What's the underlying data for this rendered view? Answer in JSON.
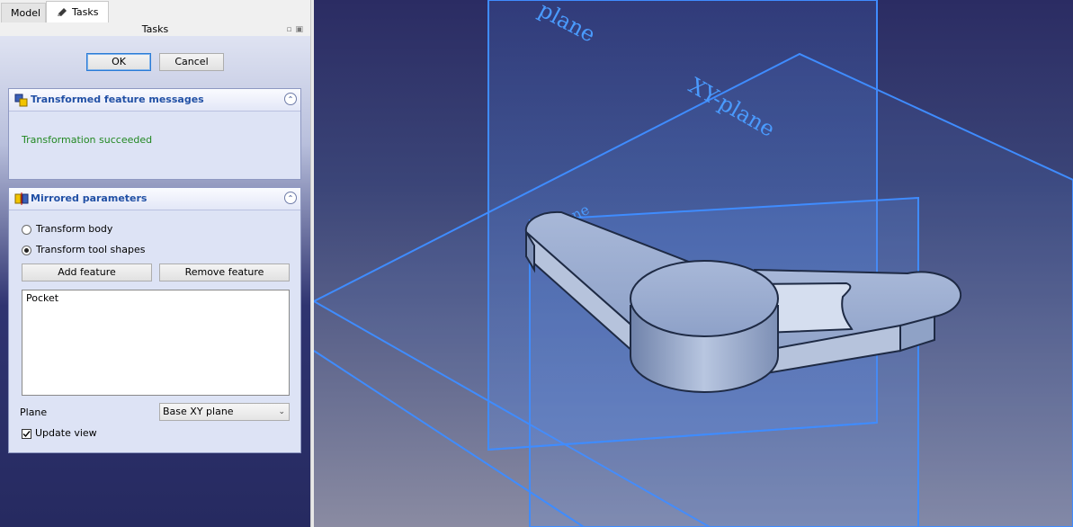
{
  "tabs": {
    "model": "Model",
    "tasks": "Tasks"
  },
  "panel_title": "Tasks",
  "dialog": {
    "ok": "OK",
    "cancel": "Cancel"
  },
  "messages": {
    "title": "Transformed feature messages",
    "text": "Transformation succeeded",
    "text_color": "#228822"
  },
  "params": {
    "title": "Mirrored parameters",
    "radio_body": "Transform body",
    "radio_tool": "Transform tool shapes",
    "selected_radio": "Transform tool shapes",
    "add_feature": "Add feature",
    "remove_feature": "Remove feature",
    "features": [
      "Pocket"
    ],
    "plane_label": "Plane",
    "plane_value": "Base XY plane",
    "update_view": "Update view",
    "update_view_checked": true
  },
  "viewport": {
    "labels": {
      "top_plane": "plane",
      "xy": "XY-plane",
      "yz": "YZ-plane"
    },
    "plane_color": "#3f8cff"
  }
}
